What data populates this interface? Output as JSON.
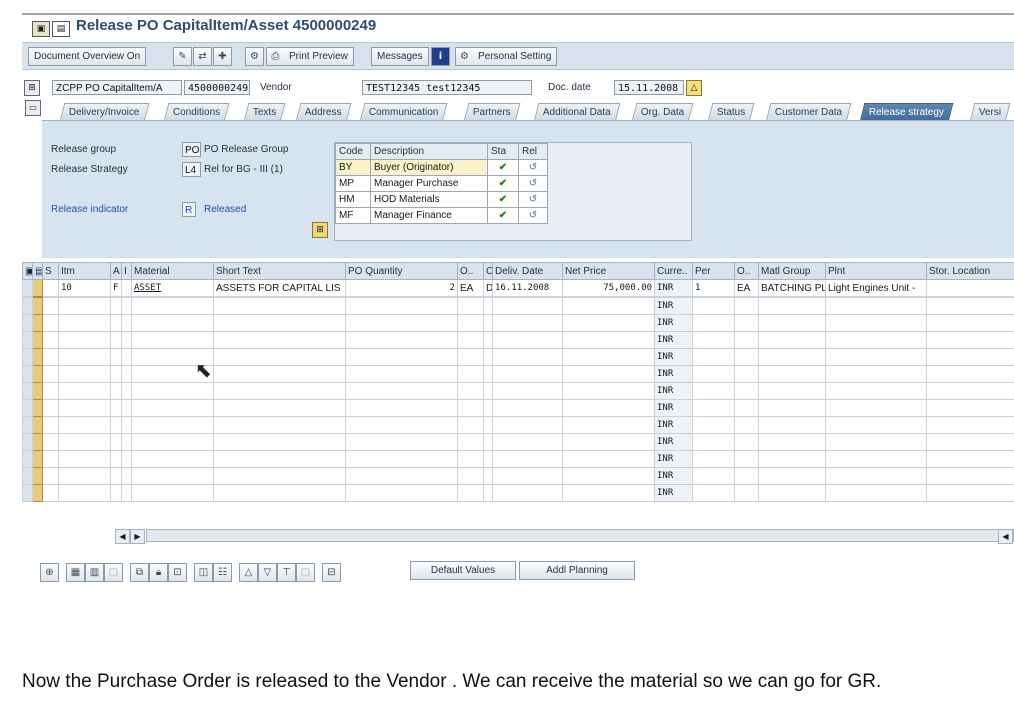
{
  "window": {
    "title": "Release PO CapitalItem/Asset 4500000249"
  },
  "app_toolbar": {
    "document_overview": "Document Overview On",
    "print_preview": "Print Preview",
    "messages": "Messages",
    "personal_setting": "Personal Setting"
  },
  "header": {
    "doc_type": "ZCPP PO CapitalItem/A",
    "po_number": "4500000249",
    "vendor_label": "Vendor",
    "vendor_value": "TEST12345 test12345",
    "doc_date_label": "Doc. date",
    "doc_date_value": "15.11.2008"
  },
  "tabs": [
    "Delivery/Invoice",
    "Conditions",
    "Texts",
    "Address",
    "Communication",
    "Partners",
    "Additional Data",
    "Org. Data",
    "Status",
    "Customer Data",
    "Release strategy",
    "Versi"
  ],
  "release": {
    "group_label": "Release group",
    "group_code": "PO",
    "group_desc": "PO Release Group",
    "strategy_label": "Release Strategy",
    "strategy_code": "L4",
    "strategy_desc": "Rel for BG - III (1)",
    "indicator_label": "Release indicator",
    "indicator_code": "R",
    "indicator_desc": "Released",
    "table_headers": [
      "Code",
      "Description",
      "Sta",
      "Rel"
    ],
    "rows": [
      {
        "code": "BY",
        "description": "Buyer (Originator)"
      },
      {
        "code": "MP",
        "description": "Manager Purchase"
      },
      {
        "code": "HM",
        "description": "HOD Materials"
      },
      {
        "code": "MF",
        "description": "Manager Finance"
      }
    ]
  },
  "items": {
    "headers": [
      "S",
      "Itm",
      "A",
      "I",
      "Material",
      "Short Text",
      "PO Quantity",
      "O..",
      "C",
      "Deliv. Date",
      "Net Price",
      "Curre..",
      "Per",
      "O..",
      "Matl Group",
      "Plnt",
      "Stor. Location"
    ],
    "row": {
      "itm": "10",
      "a": "F",
      "material": "ASSET",
      "short_text": "ASSETS FOR CAPITAL LIS",
      "qty": "2",
      "ouom": "EA",
      "c": "D",
      "deliv_date": "16.11.2008",
      "net_price": "75,000.00",
      "currency": "INR",
      "per": "1",
      "ouom2": "EA",
      "matl_group": "BATCHING PL",
      "plnt": "Light Engines Unit -",
      "stor": ""
    },
    "empty_currency": "INR"
  },
  "bottom_toolbar": {
    "default_values": "Default Values",
    "addl_planning": "Addl Planning"
  },
  "caption": "Now the Purchase Order is released to the Vendor . We can receive  the material  so we can go for GR."
}
